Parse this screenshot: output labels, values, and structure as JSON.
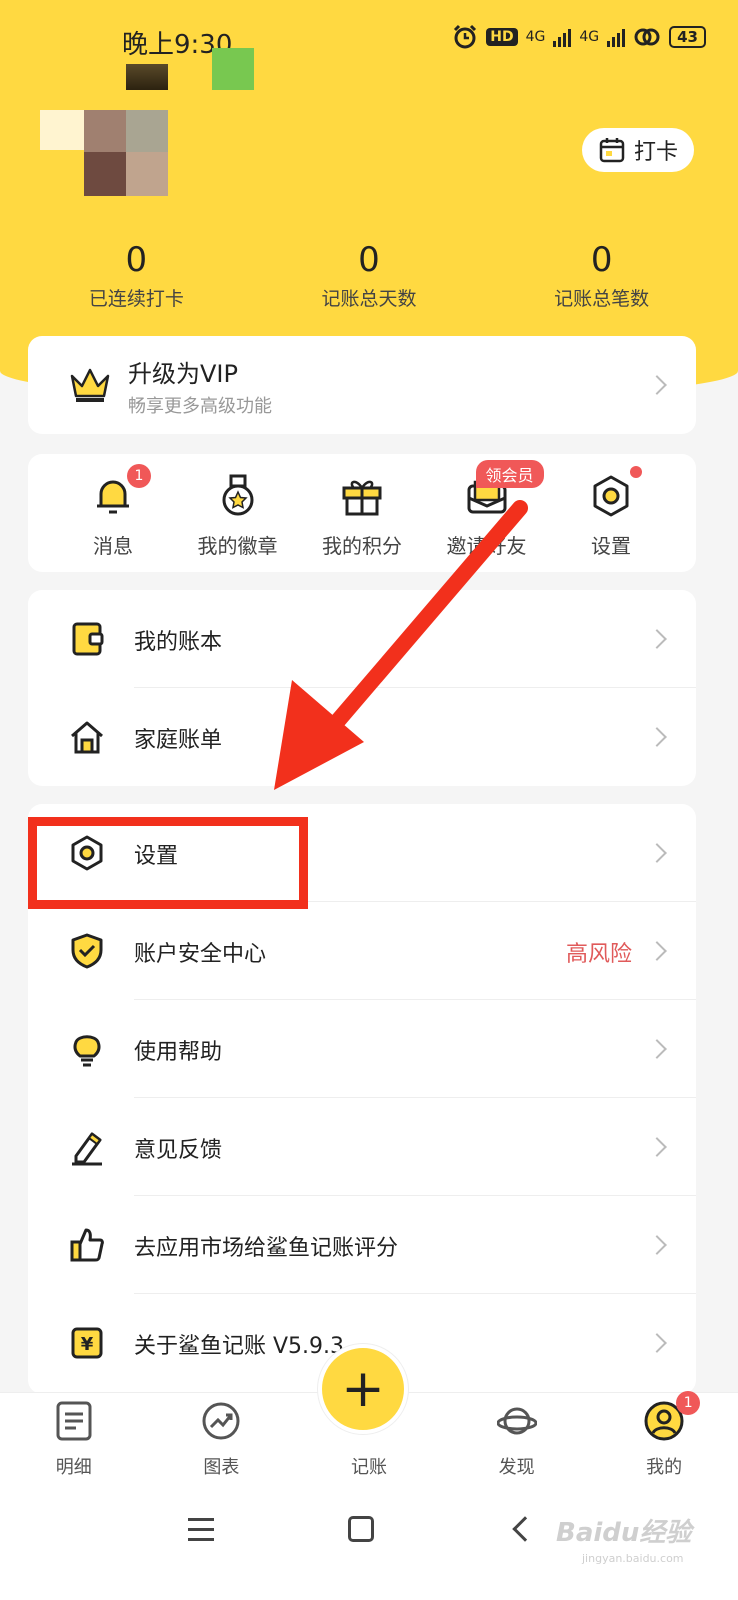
{
  "status_bar": {
    "time": "晚上9:30",
    "hd": "HD",
    "net1": "4G",
    "net2": "4G",
    "battery": "43"
  },
  "header": {
    "checkin_label": "打卡"
  },
  "stats": [
    {
      "value": "0",
      "label": "已连续打卡"
    },
    {
      "value": "0",
      "label": "记账总天数"
    },
    {
      "value": "0",
      "label": "记账总笔数"
    }
  ],
  "vip": {
    "title": "升级为VIP",
    "subtitle": "畅享更多高级功能"
  },
  "quick_actions": [
    {
      "label": "消息",
      "icon": "bell-icon",
      "badge": "1"
    },
    {
      "label": "我的徽章",
      "icon": "medal-icon"
    },
    {
      "label": "我的积分",
      "icon": "gift-icon"
    },
    {
      "label": "邀请好友",
      "icon": "envelope-icon",
      "tag": "领会员"
    },
    {
      "label": "设置",
      "icon": "hexagon-gear-icon"
    }
  ],
  "menu_group1": [
    {
      "label": "我的账本",
      "icon": "ledger-icon"
    },
    {
      "label": "家庭账单",
      "icon": "house-icon"
    }
  ],
  "menu_group2": [
    {
      "label": "设置",
      "icon": "hexagon-gear-icon"
    },
    {
      "label": "账户安全中心",
      "icon": "shield-icon",
      "extra": "高风险"
    },
    {
      "label": "使用帮助",
      "icon": "lightbulb-icon"
    },
    {
      "label": "意见反馈",
      "icon": "pencil-icon"
    },
    {
      "label": "去应用市场给鲨鱼记账评分",
      "icon": "thumbs-up-icon"
    },
    {
      "label": "关于鲨鱼记账 V5.9.3",
      "icon": "yen-icon"
    }
  ],
  "tabbar": [
    {
      "label": "明细",
      "icon": "document-icon"
    },
    {
      "label": "图表",
      "icon": "chart-icon"
    },
    {
      "label": "记账",
      "icon": "plus-icon"
    },
    {
      "label": "发现",
      "icon": "planet-icon"
    },
    {
      "label": "我的",
      "icon": "user-icon",
      "badge": "1"
    }
  ],
  "fab": "+",
  "watermark": {
    "text": "Baidu经验",
    "sub": "jingyan.baidu.com"
  },
  "colors": {
    "accent": "#ffd941",
    "alert": "#f05858",
    "annotation": "#f2301c"
  }
}
